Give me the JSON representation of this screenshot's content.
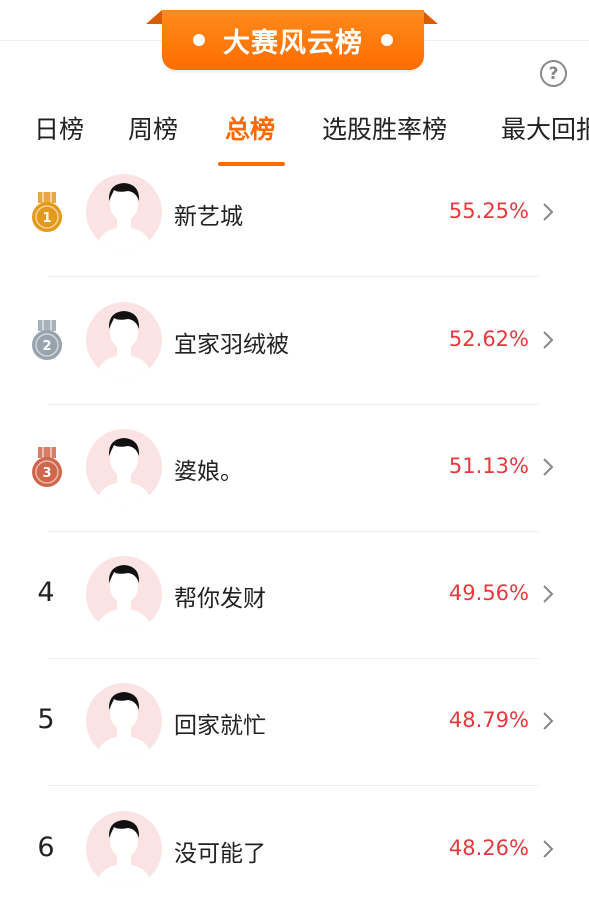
{
  "banner": {
    "title": "大赛风云榜"
  },
  "help": {
    "glyph": "?"
  },
  "tabs": [
    {
      "label": "日榜",
      "active": false
    },
    {
      "label": "周榜",
      "active": false
    },
    {
      "label": "总榜",
      "active": true
    },
    {
      "label": "选股胜率榜",
      "active": false
    },
    {
      "label": "最大回报",
      "active": false
    }
  ],
  "ranking": [
    {
      "rank": "1",
      "medal": "gold",
      "name": "新艺城",
      "rate": "55.25%"
    },
    {
      "rank": "2",
      "medal": "silver",
      "name": "宜家羽绒被",
      "rate": "52.62%"
    },
    {
      "rank": "3",
      "medal": "bronze",
      "name": "婆娘。",
      "rate": "51.13%"
    },
    {
      "rank": "4",
      "medal": null,
      "name": "帮你发财",
      "rate": "49.56%"
    },
    {
      "rank": "5",
      "medal": null,
      "name": "回家就忙",
      "rate": "48.79%"
    },
    {
      "rank": "6",
      "medal": null,
      "name": "没可能了",
      "rate": "48.26%"
    }
  ],
  "colors": {
    "accent": "#ff6a00",
    "rate": "#e8383d",
    "avatar_bg": "#fbe3e4",
    "gold": "#e39a1c",
    "silver": "#98a3ad",
    "bronze": "#d0664b"
  },
  "icons": {
    "help": "question-circle-icon",
    "chevron": "chevron-right-icon",
    "avatar": "default-user-avatar-icon",
    "medal": "medal-icon"
  }
}
